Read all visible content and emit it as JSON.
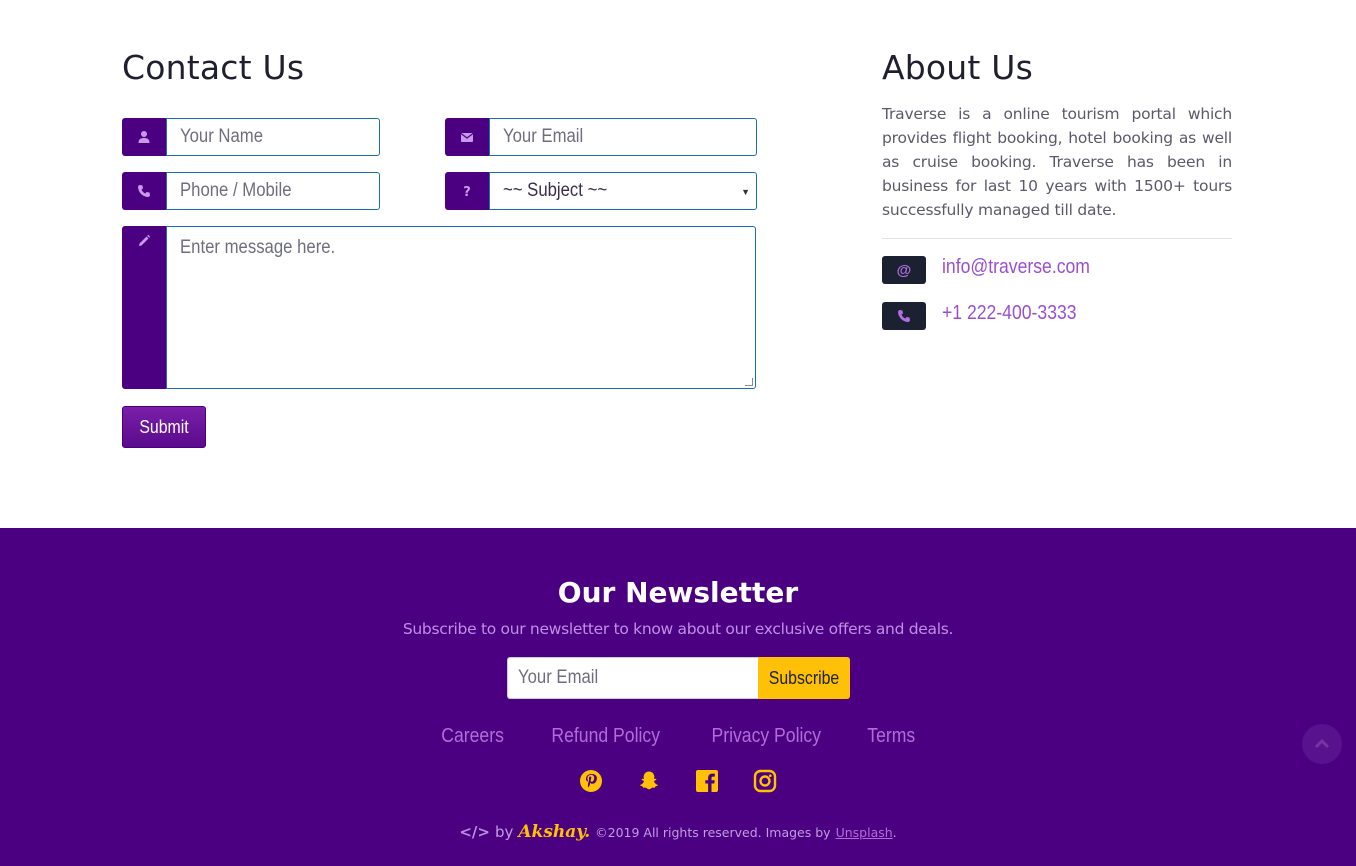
{
  "contact": {
    "title": "Contact Us",
    "name_placeholder": "Your Name",
    "email_placeholder": "Your Email",
    "phone_placeholder": "Phone / Mobile",
    "subject_selected": "~~ Subject ~~",
    "message_placeholder": "Enter message here.",
    "submit_label": "Submit",
    "icons": [
      "user-icon",
      "envelope-icon",
      "phone-icon",
      "question-icon",
      "pencil-icon"
    ]
  },
  "about": {
    "title": "About Us",
    "text": "Traverse is a online tourism portal which provides flight booking, hotel booking as well as cruise booking. Traverse has been in business for last 10 years with 1500+ tours successfully managed till date.",
    "email_badge": "@",
    "email": "info@traverse.com",
    "phone": "+1 222-400-3333"
  },
  "newsletter": {
    "title": "Our Newsletter",
    "subtitle": "Subscribe to our newsletter to know about our exclusive offers and deals.",
    "email_placeholder": "Your Email",
    "subscribe_label": "Subscribe"
  },
  "footer": {
    "links": [
      "Careers",
      "Refund Policy",
      "Privacy Policy",
      "Terms"
    ],
    "socials": [
      "pinterest-icon",
      "snapchat-icon",
      "facebook-icon",
      "instagram-icon"
    ],
    "credit_code": "</>",
    "credit_by": "by",
    "credit_author": "Akshay.",
    "credit_rights": "©2019 All rights reserved. Images by",
    "credit_images": "Unsplash",
    "credit_end": "."
  },
  "colors": {
    "brand_purple": "#4b0082",
    "accent_yellow": "#ffc107",
    "link_purple": "#b26cd8"
  }
}
